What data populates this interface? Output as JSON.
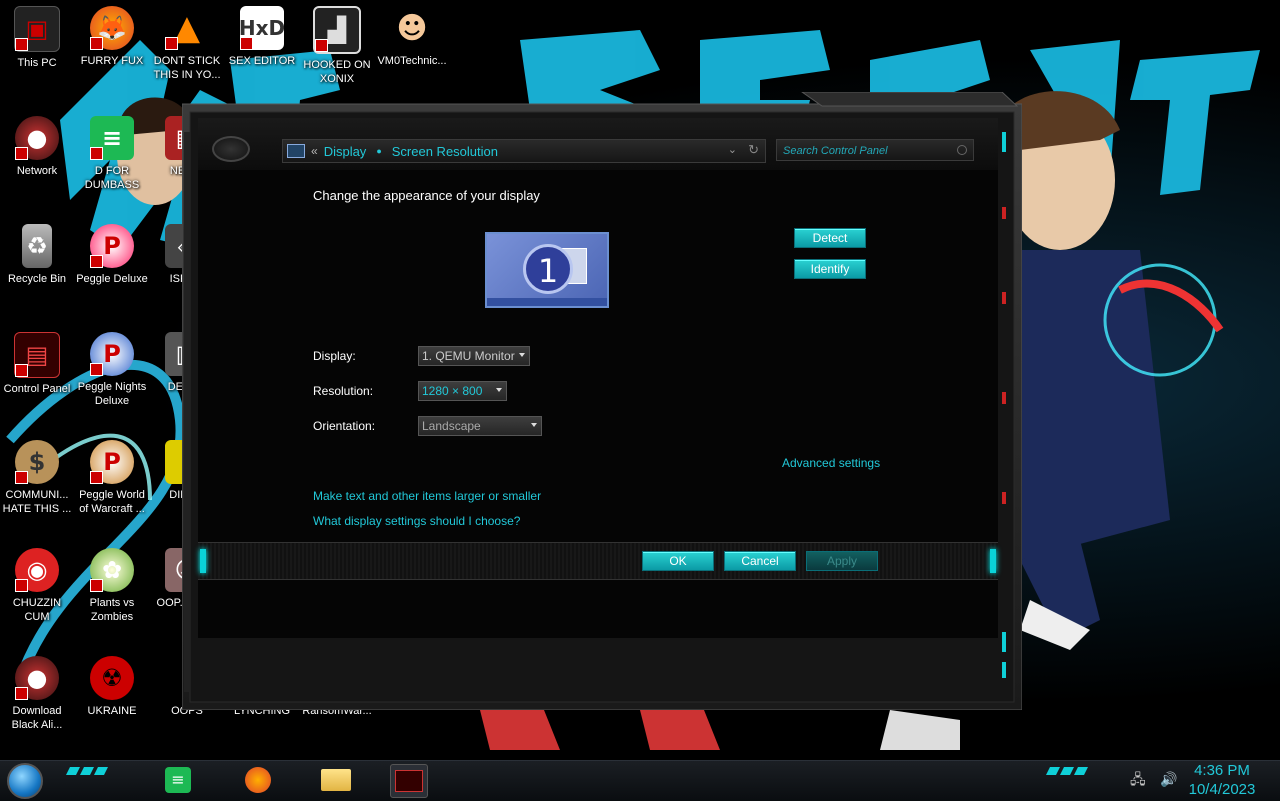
{
  "desktop": {
    "background_text": "MR BEAST",
    "icons": [
      {
        "label": "This PC"
      },
      {
        "label": "FURRY FUX"
      },
      {
        "label": "DONT STICK THIS IN YO..."
      },
      {
        "label": "SEX EDITOR"
      },
      {
        "label": "HOOKED ON XONIX"
      },
      {
        "label": "VM0Technic..."
      },
      {
        "label": "Network"
      },
      {
        "label": "D FOR DUMBASS"
      },
      {
        "label": "NEW..."
      },
      {
        "label": "Recycle Bin"
      },
      {
        "label": "Peggle Deluxe"
      },
      {
        "label": "ISRA..."
      },
      {
        "label": "Control Panel"
      },
      {
        "label": "Peggle Nights Deluxe"
      },
      {
        "label": "DEEZ..."
      },
      {
        "label": "COMMUNI... HATE THIS ..."
      },
      {
        "label": "Peggle World of Warcraft ..."
      },
      {
        "label": "DIER..."
      },
      {
        "label": "CHUZZIN CUM"
      },
      {
        "label": "Plants vs Zombies"
      },
      {
        "label": "OOP... DO..."
      },
      {
        "label": "Download Black Ali..."
      },
      {
        "label": "UKRAINE"
      },
      {
        "label": "OOPS"
      },
      {
        "label": "LYNCHING"
      },
      {
        "label": "RansomWar..."
      }
    ]
  },
  "window": {
    "breadcrumb": {
      "prefix": "«",
      "items": [
        "Display",
        "Screen Resolution"
      ]
    },
    "search_placeholder": "Search Control Panel",
    "heading": "Change the appearance of your display",
    "monitor_number": "1",
    "detect_label": "Detect",
    "identify_label": "Identify",
    "display_label": "Display:",
    "display_value": "1. QEMU Monitor",
    "resolution_label": "Resolution:",
    "resolution_value": "1280 × 800",
    "orientation_label": "Orientation:",
    "orientation_value": "Landscape",
    "advanced_link": "Advanced settings",
    "link_text_size": "Make text and other items larger or smaller",
    "link_help": "What display settings should I choose?",
    "ok_label": "OK",
    "cancel_label": "Cancel",
    "apply_label": "Apply"
  },
  "taskbar": {
    "clock_time": "4:36 PM",
    "clock_date": "10/4/2023",
    "pinned": [
      "notes",
      "firefox",
      "file-explorer",
      "control-panel"
    ]
  },
  "colors": {
    "accent_cyan": "#22c8d8",
    "window_bg": "#050505"
  }
}
